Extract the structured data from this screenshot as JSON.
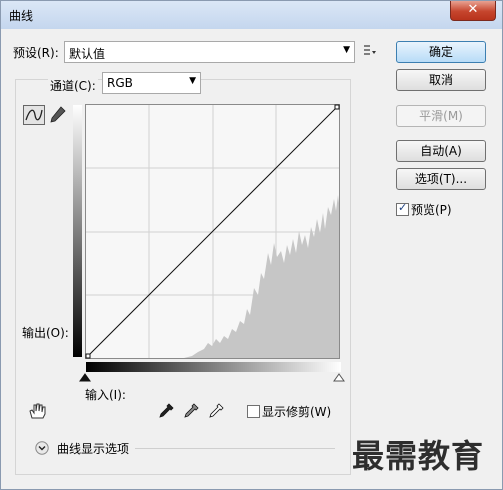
{
  "window": {
    "title": "曲线",
    "close_glyph": "✕"
  },
  "preset": {
    "label": "预设(R):",
    "value": "默认值"
  },
  "channel": {
    "label": "通道(C):",
    "value": "RGB"
  },
  "buttons": {
    "ok": "确定",
    "cancel": "取消",
    "smooth": "平滑(M)",
    "auto": "自动(A)",
    "options": "选项(T)..."
  },
  "preview": {
    "label": "预览(P)",
    "checked": true
  },
  "graph": {
    "output_label": "输出(O):",
    "input_label": "输入(I):"
  },
  "clipping": {
    "label": "显示修剪(W)",
    "checked": false
  },
  "display_options": {
    "label": "曲线显示选项"
  },
  "watermark": "最需教育",
  "icons": [
    "curve-tool-icon",
    "pencil-icon",
    "preset-menu-icon",
    "hand-adjust-icon",
    "black-eyedropper-icon",
    "gray-eyedropper-icon",
    "white-eyedropper-icon",
    "expand-chevron-icon"
  ]
}
